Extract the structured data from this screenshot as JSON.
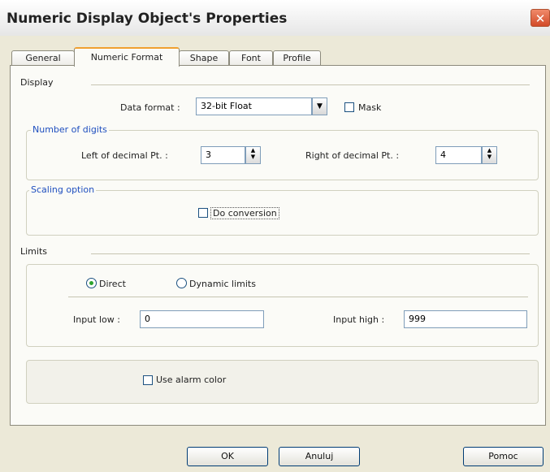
{
  "window": {
    "title": "Numeric Display Object's Properties"
  },
  "tabs": [
    {
      "label": "General"
    },
    {
      "label": "Numeric Format"
    },
    {
      "label": "Shape"
    },
    {
      "label": "Font"
    },
    {
      "label": "Profile"
    }
  ],
  "display": {
    "group_label": "Display",
    "data_format_label": "Data format :",
    "data_format_value": "32-bit Float",
    "mask_label": "Mask",
    "mask_checked": false
  },
  "digits": {
    "group_label": "Number of digits",
    "left_label": "Left of decimal Pt. :",
    "left_value": "3",
    "right_label": "Right of decimal Pt. :",
    "right_value": "4"
  },
  "scaling": {
    "group_label": "Scaling option",
    "conversion_label": "Do conversion",
    "conversion_checked": false
  },
  "limits": {
    "group_label": "Limits",
    "direct_label": "Direct",
    "dynamic_label": "Dynamic limits",
    "selected": "Direct",
    "input_low_label": "Input low :",
    "input_low_value": "0",
    "input_high_label": "Input high :",
    "input_high_value": "999"
  },
  "alarm": {
    "use_alarm_color_label": "Use alarm color",
    "checked": false
  },
  "buttons": {
    "ok": "OK",
    "cancel": "Anuluj",
    "help": "Pomoc"
  },
  "colors": {
    "group_label_blue": "#1f4fbf",
    "active_tab_accent": "#f0a030",
    "radio_selected": "#2ea32e"
  }
}
